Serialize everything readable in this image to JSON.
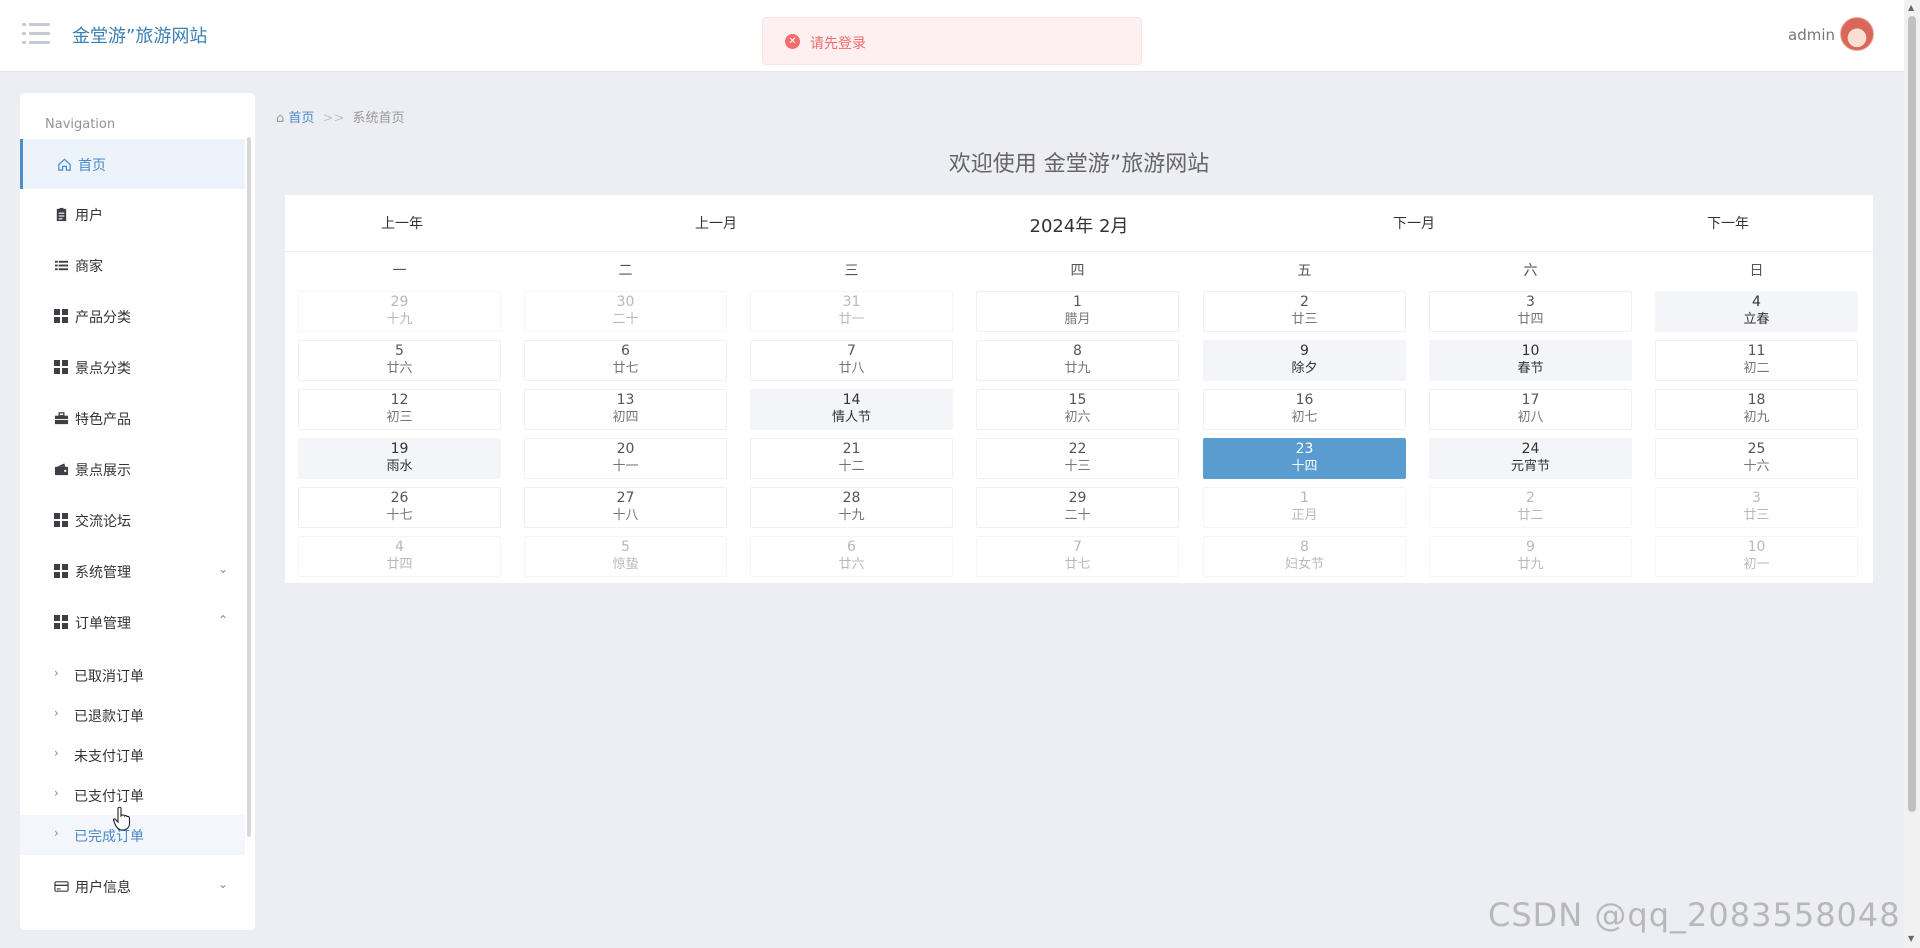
{
  "header": {
    "site_title": "金堂游”旅游网站",
    "user_name": "admin"
  },
  "toast": {
    "message": "请先登录",
    "icon": "close-circle-icon",
    "color": "#f56c6c"
  },
  "sidebar": {
    "heading": "Navigation",
    "items": [
      {
        "label": "首页",
        "icon": "home-icon",
        "active": true
      },
      {
        "label": "用户",
        "icon": "clipboard-icon"
      },
      {
        "label": "商家",
        "icon": "list-icon"
      },
      {
        "label": "产品分类",
        "icon": "grid-icon"
      },
      {
        "label": "景点分类",
        "icon": "grid-icon"
      },
      {
        "label": "特色产品",
        "icon": "briefcase-icon"
      },
      {
        "label": "景点展示",
        "icon": "wallet-icon"
      },
      {
        "label": "交流论坛",
        "icon": "grid-icon"
      },
      {
        "label": "系统管理",
        "icon": "grid-icon",
        "expandable": true,
        "expanded": false
      },
      {
        "label": "订单管理",
        "icon": "grid-icon",
        "expandable": true,
        "expanded": true
      }
    ],
    "order_subitems": [
      "已取消订单",
      "已退款订单",
      "未支付订单",
      "已支付订单",
      "已完成订单"
    ],
    "user_info": {
      "label": "用户信息",
      "icon": "card-icon"
    }
  },
  "breadcrumb": {
    "home": "首页",
    "separator": ">>",
    "current": "系统首页"
  },
  "welcome": "欢迎使用 金堂游”旅游网站",
  "calendar": {
    "prev_year": "上一年",
    "prev_month": "上一月",
    "title": "2024年 2月",
    "next_month": "下一月",
    "next_year": "下一年",
    "weekdays": [
      "一",
      "二",
      "三",
      "四",
      "五",
      "六",
      "日"
    ],
    "weeks": [
      [
        {
          "d": "29",
          "l": "十九",
          "type": "other"
        },
        {
          "d": "30",
          "l": "二十",
          "type": "other"
        },
        {
          "d": "31",
          "l": "廿一",
          "type": "other"
        },
        {
          "d": "1",
          "l": "腊月",
          "type": "normal"
        },
        {
          "d": "2",
          "l": "廿三",
          "type": "normal"
        },
        {
          "d": "3",
          "l": "廿四",
          "type": "normal"
        },
        {
          "d": "4",
          "l": "立春",
          "type": "holiday"
        }
      ],
      [
        {
          "d": "5",
          "l": "廿六",
          "type": "normal"
        },
        {
          "d": "6",
          "l": "廿七",
          "type": "normal"
        },
        {
          "d": "7",
          "l": "廿八",
          "type": "normal"
        },
        {
          "d": "8",
          "l": "廿九",
          "type": "normal"
        },
        {
          "d": "9",
          "l": "除夕",
          "type": "holiday"
        },
        {
          "d": "10",
          "l": "春节",
          "type": "holiday"
        },
        {
          "d": "11",
          "l": "初二",
          "type": "normal"
        }
      ],
      [
        {
          "d": "12",
          "l": "初三",
          "type": "normal"
        },
        {
          "d": "13",
          "l": "初四",
          "type": "normal"
        },
        {
          "d": "14",
          "l": "情人节",
          "type": "holiday"
        },
        {
          "d": "15",
          "l": "初六",
          "type": "normal"
        },
        {
          "d": "16",
          "l": "初七",
          "type": "normal"
        },
        {
          "d": "17",
          "l": "初八",
          "type": "normal"
        },
        {
          "d": "18",
          "l": "初九",
          "type": "normal"
        }
      ],
      [
        {
          "d": "19",
          "l": "雨水",
          "type": "holiday"
        },
        {
          "d": "20",
          "l": "十一",
          "type": "normal"
        },
        {
          "d": "21",
          "l": "十二",
          "type": "normal"
        },
        {
          "d": "22",
          "l": "十三",
          "type": "normal"
        },
        {
          "d": "23",
          "l": "十四",
          "type": "today"
        },
        {
          "d": "24",
          "l": "元宵节",
          "type": "holiday"
        },
        {
          "d": "25",
          "l": "十六",
          "type": "normal"
        }
      ],
      [
        {
          "d": "26",
          "l": "十七",
          "type": "normal"
        },
        {
          "d": "27",
          "l": "十八",
          "type": "normal"
        },
        {
          "d": "28",
          "l": "十九",
          "type": "normal"
        },
        {
          "d": "29",
          "l": "二十",
          "type": "normal"
        },
        {
          "d": "1",
          "l": "正月",
          "type": "other"
        },
        {
          "d": "2",
          "l": "廿二",
          "type": "other"
        },
        {
          "d": "3",
          "l": "廿三",
          "type": "other"
        }
      ],
      [
        {
          "d": "4",
          "l": "廿四",
          "type": "other"
        },
        {
          "d": "5",
          "l": "惊蛰",
          "type": "other"
        },
        {
          "d": "6",
          "l": "廿六",
          "type": "other"
        },
        {
          "d": "7",
          "l": "廿七",
          "type": "other"
        },
        {
          "d": "8",
          "l": "妇女节",
          "type": "other"
        },
        {
          "d": "9",
          "l": "廿九",
          "type": "other"
        },
        {
          "d": "10",
          "l": "初一",
          "type": "other"
        }
      ]
    ]
  },
  "watermark": "CSDN @qq_2083558048",
  "colors": {
    "accent": "#4a8bc7",
    "today": "#5a9cd0",
    "page_bg": "#edeef4"
  }
}
